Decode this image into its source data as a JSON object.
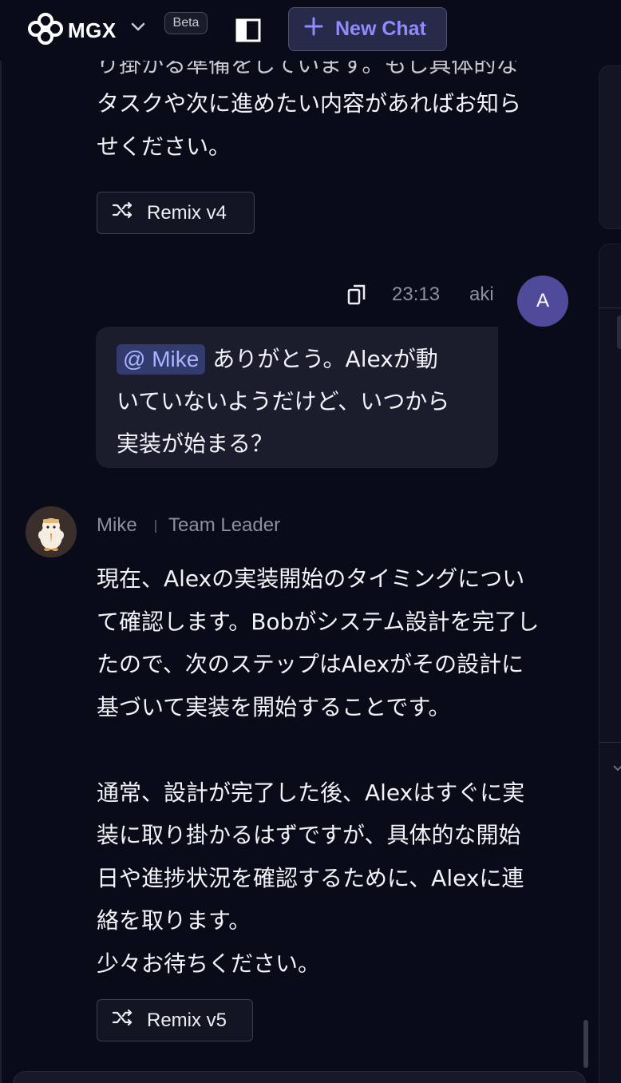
{
  "header": {
    "logo_text": "MGX",
    "beta_label": "Beta",
    "new_chat_label": "New Chat"
  },
  "previous_message": {
    "partial_line": "り掛かる準備をしています。もし具体的な",
    "text": "タスクや次に進めたい内容があればお知ら\nせください。",
    "remix_label": "Remix v4"
  },
  "user_message": {
    "time": "23:13",
    "username": "aki",
    "avatar_initial": "A",
    "mention": "@ Mike",
    "text_after_mention": " ありがとう。Alexが動\nいていないようだけど、いつから\n実装が始まる？"
  },
  "agent_message": {
    "name": "Mike",
    "role": "Team Leader",
    "text": "現在、Alexの実装開始のタイミングについ\nて確認します。Bobがシステム設計を完了し\nたので、次のステップはAlexがその設計に\n基づいて実装を開始することです。\n\n通常、設計が完了した後、Alexはすぐに実\n装に取り掛かるはずですが、具体的な開始\n日や進捗状況を確認するために、Alexに連\n絡を取ります。\n少々お待ちください。",
    "remix_label": "Remix v5"
  },
  "colors": {
    "background": "#0a0b18",
    "accent": "#8f8cff",
    "user_avatar": "#504a9a",
    "mention_bg": "#333a6e"
  },
  "icons": {
    "logo": "mgx-logo-icon",
    "dropdown": "chevron-down-icon",
    "sidebar": "sidebar-toggle-icon",
    "new_chat": "plus-icon",
    "remix": "shuffle-icon",
    "copy": "copy-icon"
  }
}
